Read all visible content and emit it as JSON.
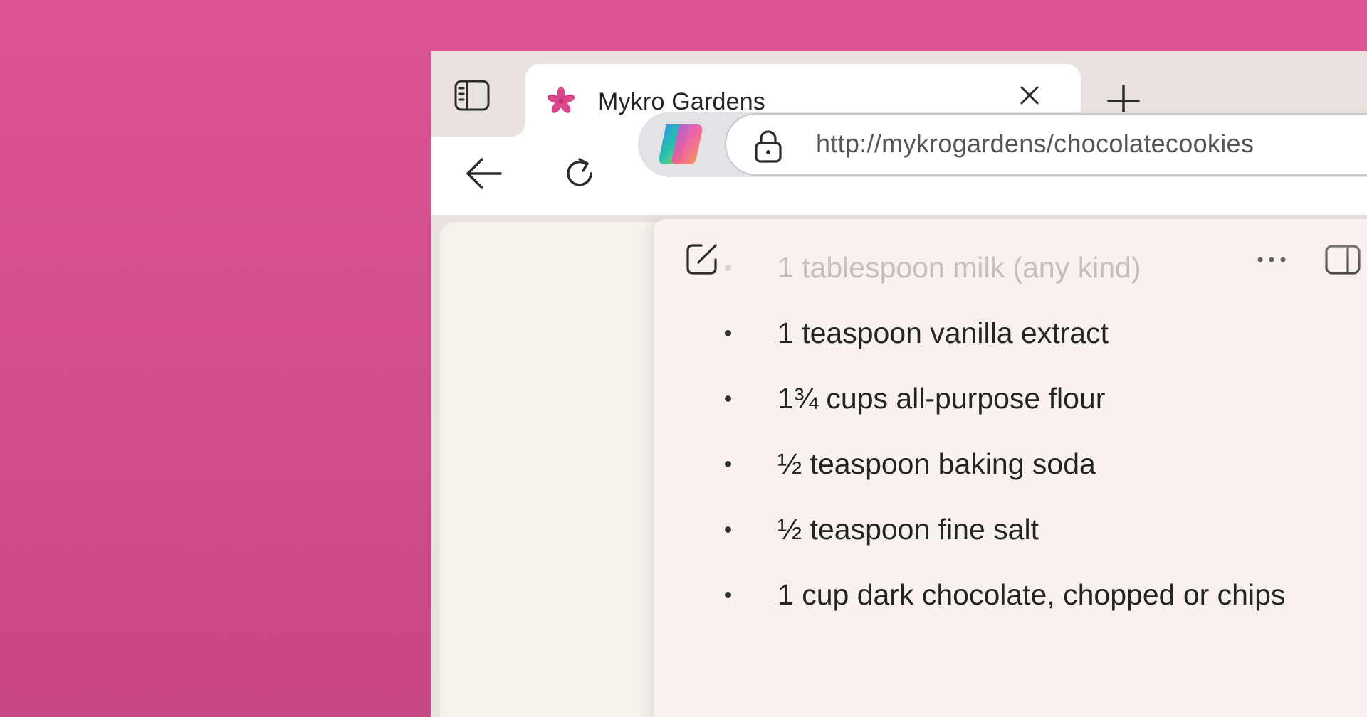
{
  "tab": {
    "title": "Mykro Gardens",
    "favicon": "flower-icon",
    "accent": "#d9468a"
  },
  "toolbar": {
    "url": "http://mykrogardens/chocolatecookies"
  },
  "copilot_pane": {
    "ingredients": [
      "1 tablespoon milk (any kind)",
      "1 teaspoon vanilla extract",
      "1¾ cups all-purpose flour",
      "½ teaspoon baking soda",
      "½ teaspoon fine salt",
      "1 cup dark chocolate, chopped or chips"
    ]
  },
  "colors": {
    "desktop_background": "#d24d8c",
    "tabstrip": "#e9e2df",
    "pane_background": "#f8f1ed"
  }
}
